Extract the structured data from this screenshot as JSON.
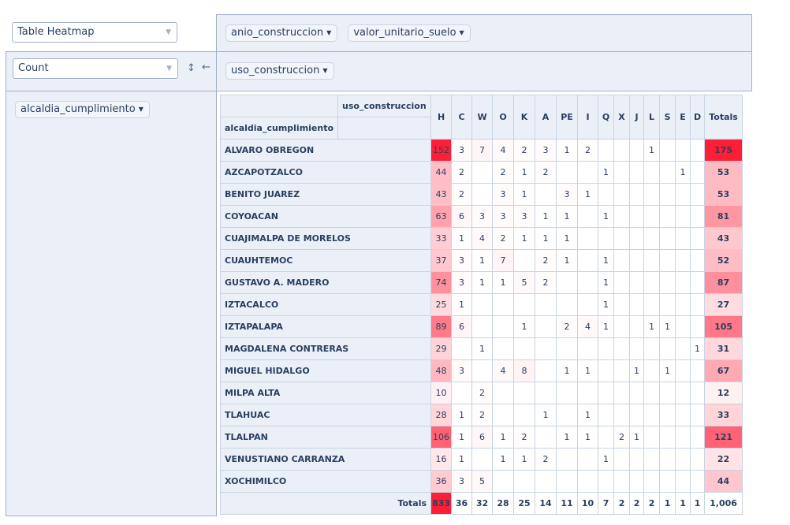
{
  "controls": {
    "renderer": "Table Heatmap",
    "aggregator": "Count",
    "sort_icon": "↕",
    "order_icon": "←"
  },
  "column_fields": [
    "anio_construccion",
    "valor_unitario_suelo"
  ],
  "row_fields_active": [
    "uso_construccion"
  ],
  "unused_fields": [
    "alcaldia_cumplimiento"
  ],
  "table": {
    "col_axis_label": "uso_construccion",
    "row_axis_label": "alcaldia_cumplimiento",
    "columns": [
      "H",
      "C",
      "W",
      "O",
      "K",
      "A",
      "PE",
      "I",
      "Q",
      "X",
      "J",
      "L",
      "S",
      "E",
      "D"
    ],
    "totals_label": "Totals",
    "rows": [
      {
        "name": "ALVARO OBREGON",
        "cells": [
          "152",
          "3",
          "7",
          "4",
          "2",
          "3",
          "1",
          "2",
          "",
          "",
          "",
          "1",
          "",
          "",
          ""
        ],
        "total": "175"
      },
      {
        "name": "AZCAPOTZALCO",
        "cells": [
          "44",
          "2",
          "",
          "2",
          "1",
          "2",
          "",
          "",
          "1",
          "",
          "",
          "",
          "",
          "1",
          ""
        ],
        "total": "53"
      },
      {
        "name": "BENITO JUAREZ",
        "cells": [
          "43",
          "2",
          "",
          "3",
          "1",
          "",
          "3",
          "1",
          "",
          "",
          "",
          "",
          "",
          "",
          ""
        ],
        "total": "53"
      },
      {
        "name": "COYOACAN",
        "cells": [
          "63",
          "6",
          "3",
          "3",
          "3",
          "1",
          "1",
          "",
          "1",
          "",
          "",
          "",
          "",
          "",
          ""
        ],
        "total": "81"
      },
      {
        "name": "CUAJIMALPA DE MORELOS",
        "cells": [
          "33",
          "1",
          "4",
          "2",
          "1",
          "1",
          "1",
          "",
          "",
          "",
          "",
          "",
          "",
          "",
          ""
        ],
        "total": "43"
      },
      {
        "name": "CUAUHTEMOC",
        "cells": [
          "37",
          "3",
          "1",
          "7",
          "",
          "2",
          "1",
          "",
          "1",
          "",
          "",
          "",
          "",
          "",
          ""
        ],
        "total": "52"
      },
      {
        "name": "GUSTAVO A. MADERO",
        "cells": [
          "74",
          "3",
          "1",
          "1",
          "5",
          "2",
          "",
          "",
          "1",
          "",
          "",
          "",
          "",
          "",
          ""
        ],
        "total": "87"
      },
      {
        "name": "IZTACALCO",
        "cells": [
          "25",
          "1",
          "",
          "",
          "",
          "",
          "",
          "",
          "1",
          "",
          "",
          "",
          "",
          "",
          ""
        ],
        "total": "27"
      },
      {
        "name": "IZTAPALAPA",
        "cells": [
          "89",
          "6",
          "",
          "",
          "1",
          "",
          "2",
          "4",
          "1",
          "",
          "",
          "1",
          "1",
          "",
          ""
        ],
        "total": "105"
      },
      {
        "name": "MAGDALENA CONTRERAS",
        "cells": [
          "29",
          "",
          "1",
          "",
          "",
          "",
          "",
          "",
          "",
          "",
          "",
          "",
          "",
          "",
          "1"
        ],
        "total": "31"
      },
      {
        "name": "MIGUEL HIDALGO",
        "cells": [
          "48",
          "3",
          "",
          "4",
          "8",
          "",
          "1",
          "1",
          "",
          "",
          "1",
          "",
          "1",
          "",
          ""
        ],
        "total": "67"
      },
      {
        "name": "MILPA ALTA",
        "cells": [
          "10",
          "",
          "2",
          "",
          "",
          "",
          "",
          "",
          "",
          "",
          "",
          "",
          "",
          "",
          ""
        ],
        "total": "12"
      },
      {
        "name": "TLAHUAC",
        "cells": [
          "28",
          "1",
          "2",
          "",
          "",
          "1",
          "",
          "1",
          "",
          "",
          "",
          "",
          "",
          "",
          ""
        ],
        "total": "33"
      },
      {
        "name": "TLALPAN",
        "cells": [
          "106",
          "1",
          "6",
          "1",
          "2",
          "",
          "1",
          "1",
          "",
          "2",
          "1",
          "",
          "",
          "",
          ""
        ],
        "total": "121"
      },
      {
        "name": "VENUSTIANO CARRANZA",
        "cells": [
          "16",
          "1",
          "",
          "1",
          "1",
          "2",
          "",
          "",
          "1",
          "",
          "",
          "",
          "",
          "",
          ""
        ],
        "total": "22"
      },
      {
        "name": "XOCHIMILCO",
        "cells": [
          "36",
          "3",
          "5",
          "",
          "",
          "",
          "",
          "",
          "",
          "",
          "",
          "",
          "",
          "",
          ""
        ],
        "total": "44"
      }
    ],
    "col_totals": [
      "833",
      "36",
      "32",
      "28",
      "25",
      "14",
      "11",
      "10",
      "7",
      "2",
      "2",
      "2",
      "1",
      "1",
      "1"
    ],
    "grand_total": "1,006"
  }
}
